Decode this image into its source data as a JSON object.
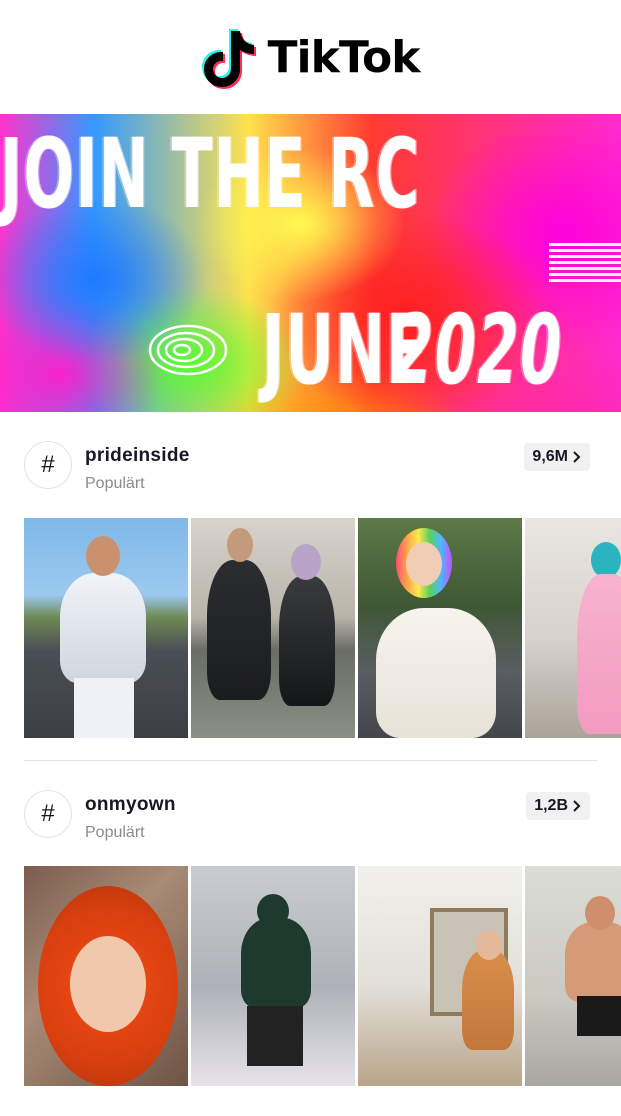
{
  "app": {
    "name": "TikTok"
  },
  "banner": {
    "line1": "JOIN THE RC",
    "line2": "JUNE",
    "line3": "2020"
  },
  "sections": [
    {
      "tag": "prideinside",
      "subtitle": "Populärt",
      "count": "9,6M",
      "hash_symbol": "#"
    },
    {
      "tag": "onmyown",
      "subtitle": "Populärt",
      "count": "1,2B",
      "hash_symbol": "#"
    }
  ],
  "icons": {
    "logo": "tiktok-note-icon",
    "hashtag": "hashtag-icon",
    "chevron": "chevron-right-icon"
  },
  "colors": {
    "logo_cyan": "#25f4ee",
    "logo_red": "#fe2c55",
    "text": "#161823",
    "muted": "#8a8b91"
  }
}
